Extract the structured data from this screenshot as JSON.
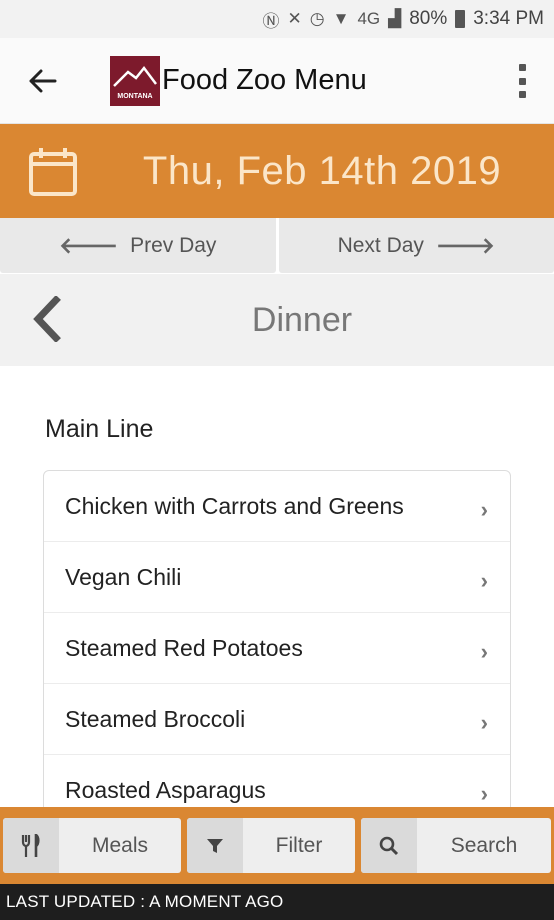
{
  "status_bar": {
    "battery": "80%",
    "time": "3:34 PM",
    "network": "4G"
  },
  "app_bar": {
    "logo_text": "MONTANA",
    "title": "Food Zoo Menu"
  },
  "date_banner": {
    "date": "Thu, Feb 14th 2019"
  },
  "day_nav": {
    "prev_label": "Prev Day",
    "next_label": "Next Day"
  },
  "meal": {
    "title": "Dinner"
  },
  "section": {
    "title": "Main Line",
    "items": [
      {
        "label": "Chicken with Carrots and Greens"
      },
      {
        "label": "Vegan Chili"
      },
      {
        "label": "Steamed Red Potatoes"
      },
      {
        "label": "Steamed Broccoli"
      },
      {
        "label": "Roasted Asparagus"
      }
    ]
  },
  "bottom_bar": {
    "meals_label": "Meals",
    "filter_label": "Filter",
    "search_label": "Search"
  },
  "footer": {
    "text": "LAST UPDATED : A MOMENT AGO"
  },
  "colors": {
    "accent": "#da8732",
    "brand": "#7d1a2c"
  }
}
